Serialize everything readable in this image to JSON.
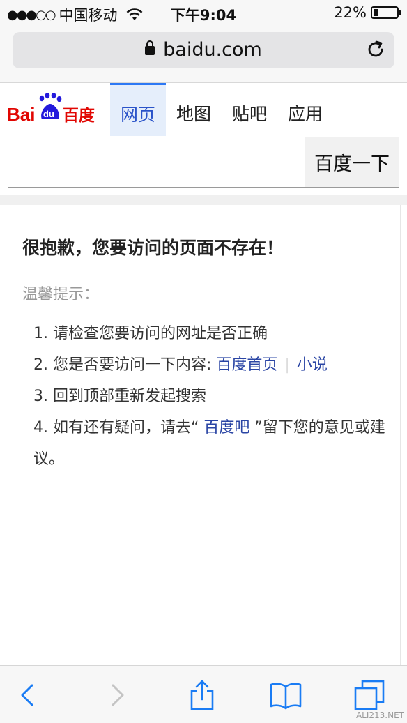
{
  "status_bar": {
    "signal": "●●●○○",
    "carrier": "中国移动",
    "time": "下午9:04",
    "battery_text": "22%",
    "battery_level": 0.22
  },
  "address_bar": {
    "url": "baidu.com"
  },
  "header": {
    "logo_text": "Bai du 百度",
    "tabs": [
      {
        "label": "网页",
        "active": true
      },
      {
        "label": "地图"
      },
      {
        "label": "贴吧"
      },
      {
        "label": "应用"
      }
    ],
    "search": {
      "value": "",
      "placeholder": "",
      "button_label": "百度一下"
    }
  },
  "error_card": {
    "title": "很抱歉，您要访问的页面不存在！",
    "tip_label": "温馨提示：",
    "tips": [
      {
        "text": "1. 请检查您要访问的网址是否正确"
      },
      {
        "prefix": "2. 您是否要访问一下内容: ",
        "link1": "百度首页",
        "separator": "|",
        "link2": "小说"
      },
      {
        "text": "3. 回到顶部重新发起搜索"
      },
      {
        "prefix": "4. 如有还有疑问，请去“ ",
        "link": "百度吧",
        "suffix": " ”留下您的意见或建议。"
      }
    ]
  },
  "toolbar": {
    "icons": [
      "back-icon",
      "forward-icon",
      "share-icon",
      "bookmarks-icon",
      "tabs-icon"
    ]
  },
  "watermark": "ALI213.NET",
  "colors": {
    "link": "#2a45a4",
    "active_tab_bg": "#e5eefb",
    "ios_blue": "#1a7cf4",
    "baidu_red": "#e10602",
    "baidu_blue": "#2319dc"
  }
}
